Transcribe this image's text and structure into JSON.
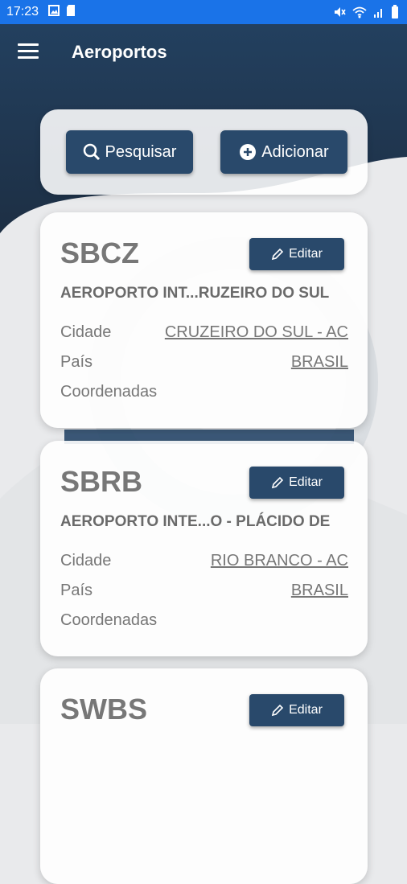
{
  "status_bar": {
    "time": "17:23"
  },
  "app_bar": {
    "title": "Aeroportos"
  },
  "actions": {
    "search_label": "Pesquisar",
    "add_label": "Adicionar"
  },
  "airports": [
    {
      "code": "SBCZ",
      "edit_label": "Editar",
      "name": "AEROPORTO INT...RUZEIRO DO SUL",
      "city_label": "Cidade",
      "city": "CRUZEIRO DO SUL - AC",
      "country_label": "País",
      "country": "BRASIL",
      "coords_label": "Coordenadas"
    },
    {
      "code": "SBRB",
      "edit_label": "Editar",
      "name": "AEROPORTO INTE...O - PLÁCIDO DE",
      "city_label": "Cidade",
      "city": "RIO BRANCO - AC",
      "country_label": "País",
      "country": "BRASIL",
      "coords_label": "Coordenadas"
    },
    {
      "code": "SWBS",
      "edit_label": "Editar"
    }
  ],
  "colors": {
    "status_bar": "#1a73e8",
    "header": "#23405f",
    "button": "#29496b"
  }
}
